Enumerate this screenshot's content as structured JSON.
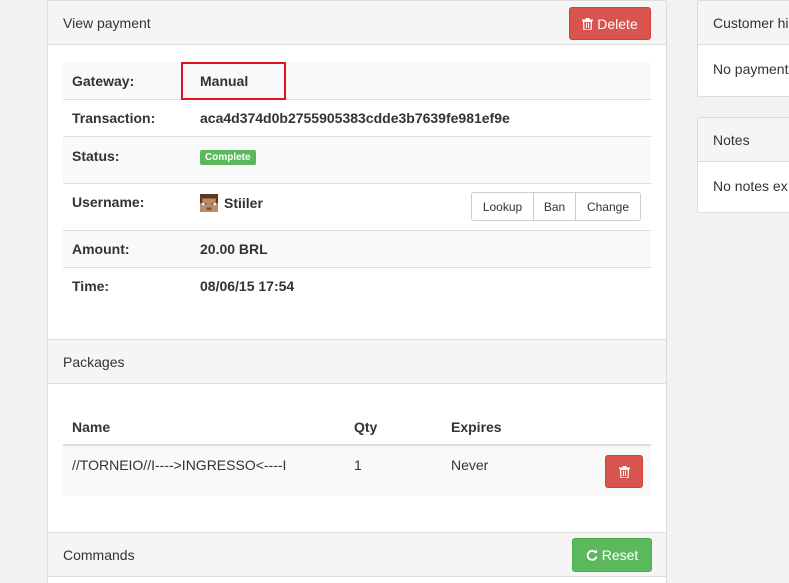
{
  "view_payment": {
    "title": "View payment",
    "delete_label": "Delete",
    "rows": {
      "gateway": {
        "label": "Gateway:",
        "value": "Manual"
      },
      "transaction": {
        "label": "Transaction:",
        "value": "aca4d374d0b2755905383cdde3b7639fe981ef9e"
      },
      "status": {
        "label": "Status:",
        "value": "Complete"
      },
      "username": {
        "label": "Username:",
        "value": "Stiiler"
      },
      "amount": {
        "label": "Amount:",
        "value": "20.00 BRL"
      },
      "time": {
        "label": "Time:",
        "value": "08/06/15 17:54"
      }
    },
    "user_actions": {
      "lookup": "Lookup",
      "ban": "Ban",
      "change": "Change"
    }
  },
  "packages": {
    "title": "Packages",
    "columns": {
      "name": "Name",
      "qty": "Qty",
      "expires": "Expires"
    },
    "items": [
      {
        "name": "//TORNEIO//I---->INGRESSO<----I",
        "qty": "1",
        "expires": "Never"
      }
    ]
  },
  "commands": {
    "title": "Commands",
    "reset_label": "Reset"
  },
  "customer_history": {
    "title": "Customer hi",
    "body": "No payment"
  },
  "notes": {
    "title": "Notes",
    "body": "No notes ex"
  },
  "colors": {
    "danger": "#d9534f",
    "success": "#5cb85c",
    "highlight": "#e0141e"
  }
}
